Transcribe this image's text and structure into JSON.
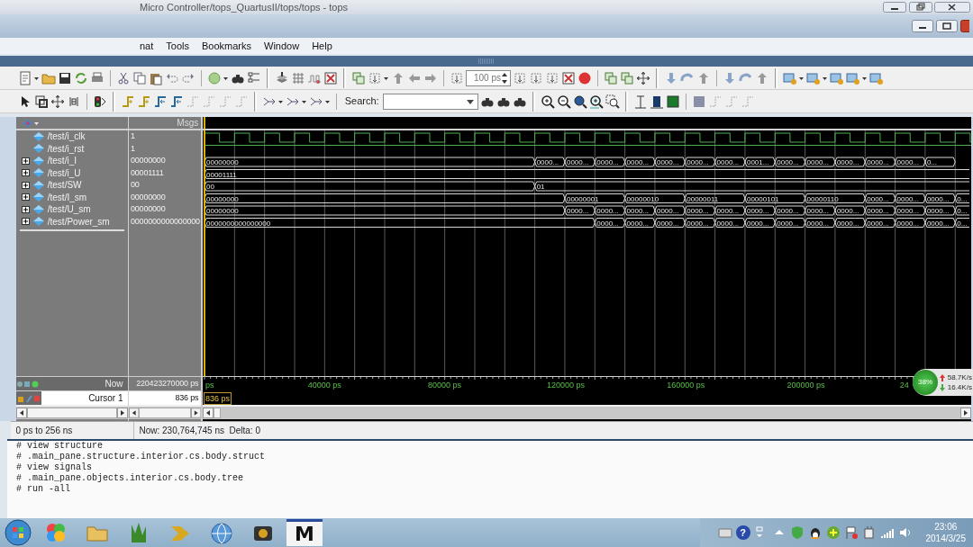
{
  "window": {
    "title": "Micro Controller/tops_QuartusII/tops/tops - tops"
  },
  "menu": [
    "nat",
    "Tools",
    "Bookmarks",
    "Window",
    "Help"
  ],
  "toolbar": {
    "time_step": "100",
    "time_unit": "ps",
    "search_label": "Search:"
  },
  "wave": {
    "header": "Msgs",
    "signals": [
      {
        "name": "/test/i_clk",
        "value": "1",
        "kind": "clock"
      },
      {
        "name": "/test/i_rst",
        "value": "1",
        "kind": "bit"
      },
      {
        "name": "/test/i_I",
        "value": "00000000",
        "kind": "bus",
        "expanded": false,
        "segments": [
          "00000000",
          "0000...",
          "0000...",
          "0000...",
          "0000...",
          "0000...",
          "0000...",
          "0000...",
          "0001...",
          "0000...",
          "0000...",
          "0000...",
          "0000...",
          "0000...",
          "0..."
        ]
      },
      {
        "name": "/test/i_U",
        "value": "00001111",
        "kind": "bus",
        "expanded": false,
        "segments": [
          "00001111"
        ]
      },
      {
        "name": "/test/SW",
        "value": "00",
        "kind": "bus",
        "expanded": false,
        "segments": [
          "00",
          "01"
        ]
      },
      {
        "name": "/test/I_sm",
        "value": "00000000",
        "kind": "bus",
        "expanded": false,
        "segments": [
          "00000000",
          "00000001",
          "00000010",
          "00000011",
          "00000101",
          "00000110",
          "0000...",
          "0000...",
          "0000...",
          "0..."
        ]
      },
      {
        "name": "/test/U_sm",
        "value": "00000000",
        "kind": "bus",
        "expanded": false,
        "segments": [
          "00000000",
          "0000...",
          "0000...",
          "0000...",
          "0000...",
          "0000...",
          "0000...",
          "0000...",
          "0000...",
          "0000...",
          "0000...",
          "0000...",
          "0000...",
          "0000...",
          "0..."
        ]
      },
      {
        "name": "/test/Power_sm",
        "value": "0000000000000000",
        "kind": "bus",
        "expanded": false,
        "segments": [
          "0000000000000000",
          "0000...",
          "0000...",
          "0000...",
          "0000...",
          "0000...",
          "0000...",
          "0000...",
          "0000...",
          "0000...",
          "0000...",
          "0000...",
          "0000...",
          "0..."
        ]
      }
    ],
    "now_label": "Now",
    "now_value": "220423270000 ps",
    "cursor_label": "Cursor 1",
    "cursor_value": "836 ps",
    "cursor_flag": "836 ps",
    "timeline": [
      "ps",
      "40000 ps",
      "80000 ps",
      "120000 ps",
      "160000 ps",
      "200000 ps",
      "24"
    ]
  },
  "status_bar": {
    "range": "0 ps to 256 ns",
    "now": "Now: 230,764,745 ns",
    "delta": "Delta: 0"
  },
  "transcript": [
    "# view structure",
    "# .main_pane.structure.interior.cs.body.struct",
    "# view signals",
    "# .main_pane.objects.interior.cs.body.tree",
    "# run -all"
  ],
  "net_meter": {
    "percent": "38%",
    "upload": "58.7K/s",
    "download": "16.4K/s"
  },
  "taskbar": {
    "app_letter": "M",
    "help_glyph": "?",
    "time": "23:06",
    "date": "2014/3/25"
  }
}
